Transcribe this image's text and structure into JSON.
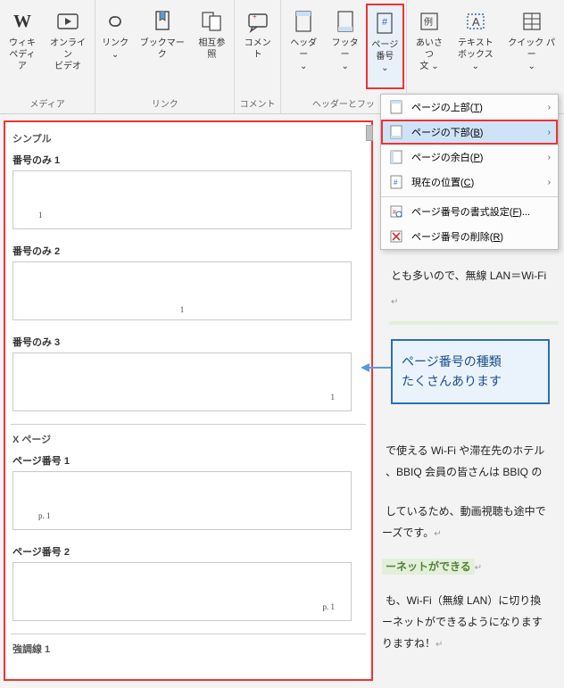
{
  "ribbon": {
    "groups": [
      {
        "label": "メディア",
        "buttons": [
          {
            "label": "ウィキ\nペディア"
          },
          {
            "label": "オンライン\nビデオ"
          }
        ]
      },
      {
        "label": "リンク",
        "buttons": [
          {
            "label": "リンク\n ⌄"
          },
          {
            "label": "ブックマーク"
          },
          {
            "label": "相互参照"
          }
        ]
      },
      {
        "label": "コメント",
        "buttons": [
          {
            "label": "コメント"
          }
        ]
      },
      {
        "label": "ヘッダーとフッ",
        "buttons": [
          {
            "label": "ヘッダー\n ⌄"
          },
          {
            "label": "フッター\n ⌄"
          },
          {
            "label": "ページ\n番号 ⌄"
          }
        ]
      },
      {
        "label": "",
        "buttons": [
          {
            "label": "あいさつ\n文 ⌄"
          },
          {
            "label": "テキスト\nボックス ⌄"
          },
          {
            "label": "クイック パー\n ⌄"
          }
        ]
      }
    ]
  },
  "dropdown": {
    "items": [
      {
        "label_pre": "ページの上部(",
        "key": "T",
        "label_post": ")",
        "submenu": true,
        "icon": "page-top"
      },
      {
        "label_pre": "ページの下部(",
        "key": "B",
        "label_post": ")",
        "submenu": true,
        "highlighted": true,
        "icon": "page-bottom"
      },
      {
        "label_pre": "ページの余白(",
        "key": "P",
        "label_post": ")",
        "submenu": true,
        "icon": "page-margin"
      },
      {
        "label_pre": "現在の位置(",
        "key": "C",
        "label_post": ")",
        "submenu": true,
        "icon": "current-pos"
      },
      {
        "sep": true
      },
      {
        "label_pre": "ページ番号の書式設定(",
        "key": "F",
        "label_post": ")...",
        "icon": "format"
      },
      {
        "label_pre": "ページ番号の削除(",
        "key": "R",
        "label_post": ")",
        "icon": "remove"
      }
    ]
  },
  "gallery": {
    "section1": "シンプル",
    "items1": [
      {
        "label": "番号のみ 1",
        "pos": "bl",
        "num": "1"
      },
      {
        "label": "番号のみ 2",
        "pos": "bc",
        "num": "1"
      },
      {
        "label": "番号のみ 3",
        "pos": "br",
        "num": "1"
      }
    ],
    "section2": "X ページ",
    "items2": [
      {
        "label": "ページ番号 1",
        "pos": "bl",
        "num": "p. 1"
      },
      {
        "label": "ページ番号 2",
        "pos": "br",
        "num": "p. 1"
      }
    ],
    "section3": "強調線 1"
  },
  "callout": {
    "line1": "ページ番号の種類",
    "line2": "たくさんあります"
  },
  "body": {
    "t1": "とも多いので、無線 LAN＝Wi-Fi",
    "t2": "で使える Wi-Fi や滞在先のホテル",
    "t3": "、BBIQ 会員の皆さんは BBIQ の",
    "t4": "しているため、動画視聴も途中で",
    "t5": "ーズです。",
    "h1": "ーネットができる",
    "t6": "も、Wi-Fi（無線 LAN）に切り換",
    "t7": "ーネットができるようになります",
    "t8": "りますね！"
  }
}
